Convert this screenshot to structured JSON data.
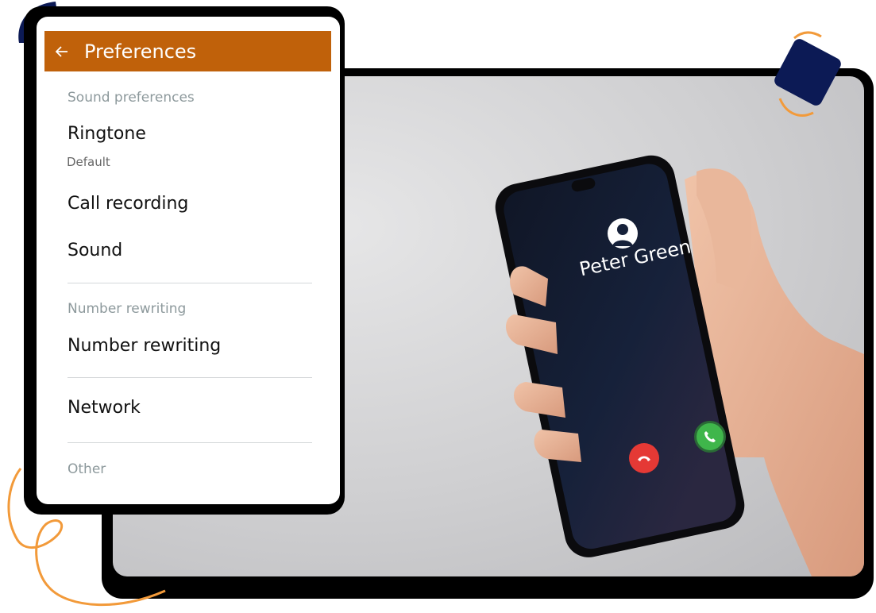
{
  "appbar": {
    "title": "Preferences",
    "back_icon": "arrow-left-icon"
  },
  "sections": [
    {
      "header": "Sound preferences"
    },
    {
      "header": "Number rewriting"
    },
    {
      "header": "Other"
    }
  ],
  "items": {
    "ringtone": {
      "label": "Ringtone",
      "summary": "Default"
    },
    "call_recording": {
      "label": "Call recording"
    },
    "sound": {
      "label": "Sound"
    },
    "number_rewriting": {
      "label": "Number rewriting"
    },
    "network": {
      "label": "Network"
    }
  },
  "phone": {
    "caller_name": "Peter Green",
    "decline_icon": "phone-hangup-icon",
    "accept_icon": "phone-icon"
  },
  "colors": {
    "appbar": "#c0610a",
    "decline": "#e53935",
    "accept": "#3fb64b",
    "accent_orange": "#f29a3a",
    "accent_navy": "#0c1a55"
  }
}
